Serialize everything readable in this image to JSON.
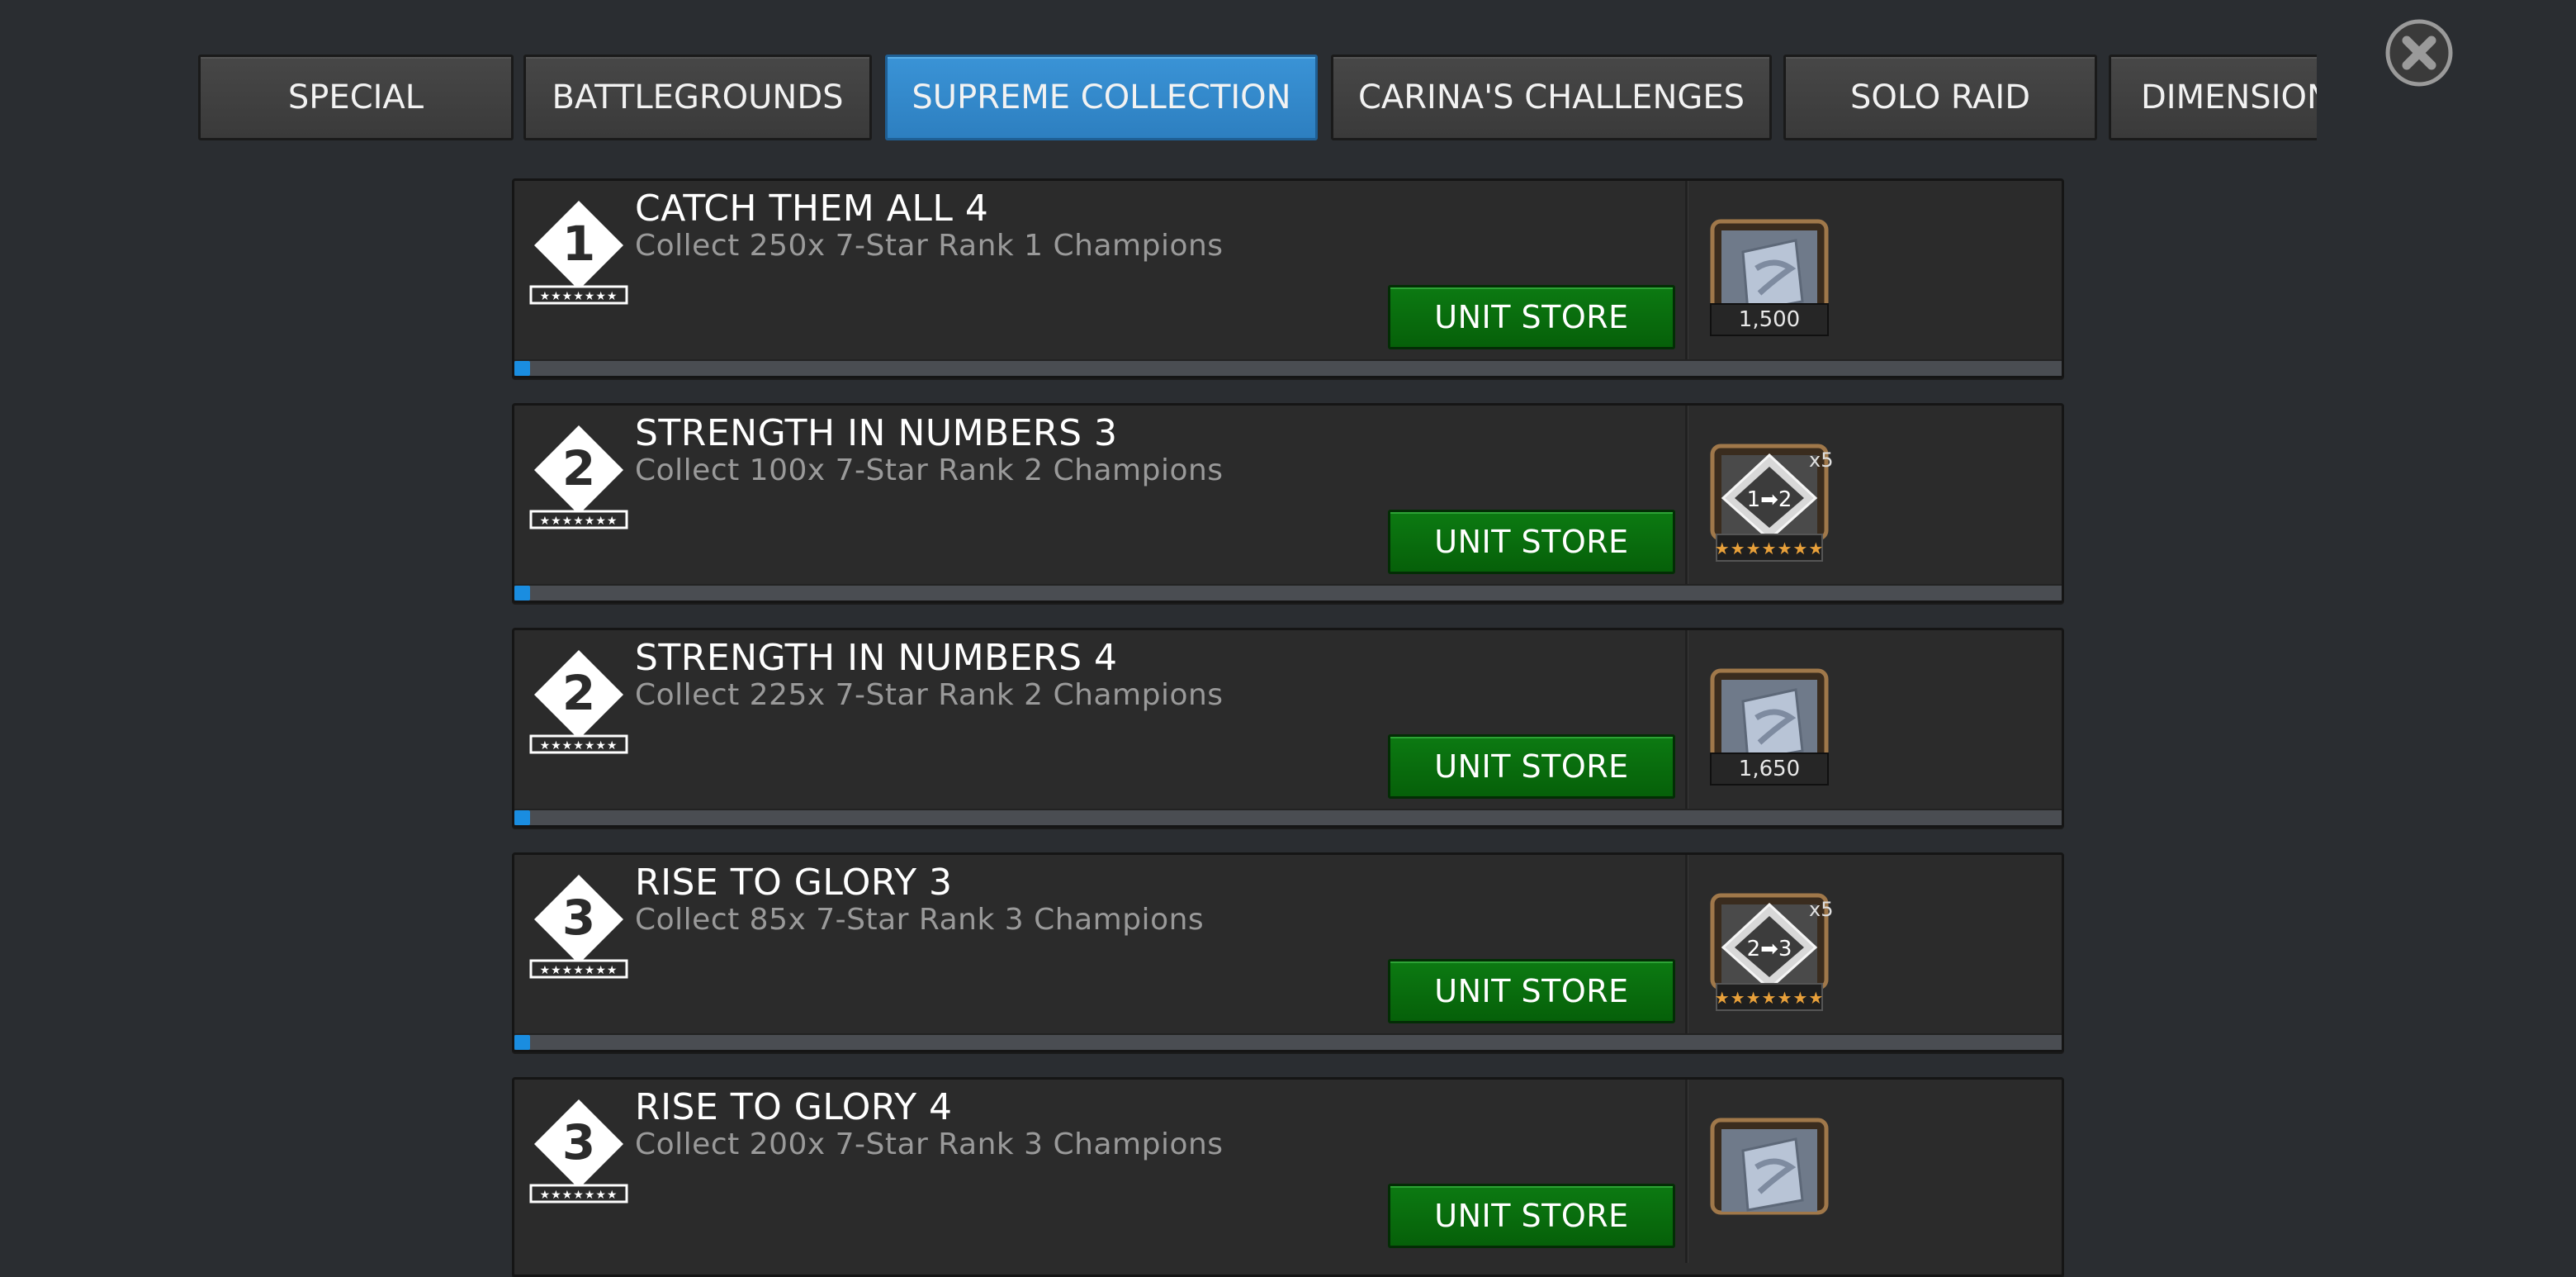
{
  "tabs": [
    {
      "label": "SPECIAL",
      "active": false
    },
    {
      "label": "BATTLEGROUNDS",
      "active": false
    },
    {
      "label": "SUPREME COLLECTION",
      "active": true
    },
    {
      "label": "CARINA'S CHALLENGES",
      "active": false
    },
    {
      "label": "SOLO RAID",
      "active": false
    },
    {
      "label": "DIMENSION",
      "active": false
    }
  ],
  "close_icon": "close-circle-icon",
  "quests": [
    {
      "badge_rank": "1",
      "title": "CATCH THEM ALL 4",
      "description": "Collect 250x 7-Star Rank 1 Champions",
      "button": "UNIT STORE",
      "progress": 0.01,
      "reward_type": "shard-card",
      "reward_count": "1,500",
      "reward_multiplier": ""
    },
    {
      "badge_rank": "2",
      "title": "STRENGTH IN NUMBERS 3",
      "description": "Collect 100x 7-Star Rank 2 Champions",
      "button": "UNIT STORE",
      "progress": 0.01,
      "reward_type": "rank-up-gem",
      "reward_label": "1➡2",
      "reward_multiplier": "x5"
    },
    {
      "badge_rank": "2",
      "title": "STRENGTH IN NUMBERS 4",
      "description": "Collect 225x 7-Star Rank 2 Champions",
      "button": "UNIT STORE",
      "progress": 0.01,
      "reward_type": "shard-card",
      "reward_count": "1,650",
      "reward_multiplier": ""
    },
    {
      "badge_rank": "3",
      "title": "RISE TO GLORY 3",
      "description": "Collect 85x 7-Star Rank 3 Champions",
      "button": "UNIT STORE",
      "progress": 0.01,
      "reward_type": "rank-up-gem",
      "reward_label": "2➡3",
      "reward_multiplier": "x5"
    },
    {
      "badge_rank": "3",
      "title": "RISE TO GLORY 4",
      "description": "Collect 200x 7-Star Rank 3 Champions",
      "button": "UNIT STORE",
      "progress": 0.01,
      "reward_type": "shard-card",
      "reward_count": "",
      "reward_multiplier": ""
    }
  ],
  "colors": {
    "background": "#2a2d31",
    "tab_active": "#3a93d6",
    "button_green": "#0c7a12",
    "progress_fill": "#1a8de0",
    "star_gold": "#e8a03a"
  }
}
